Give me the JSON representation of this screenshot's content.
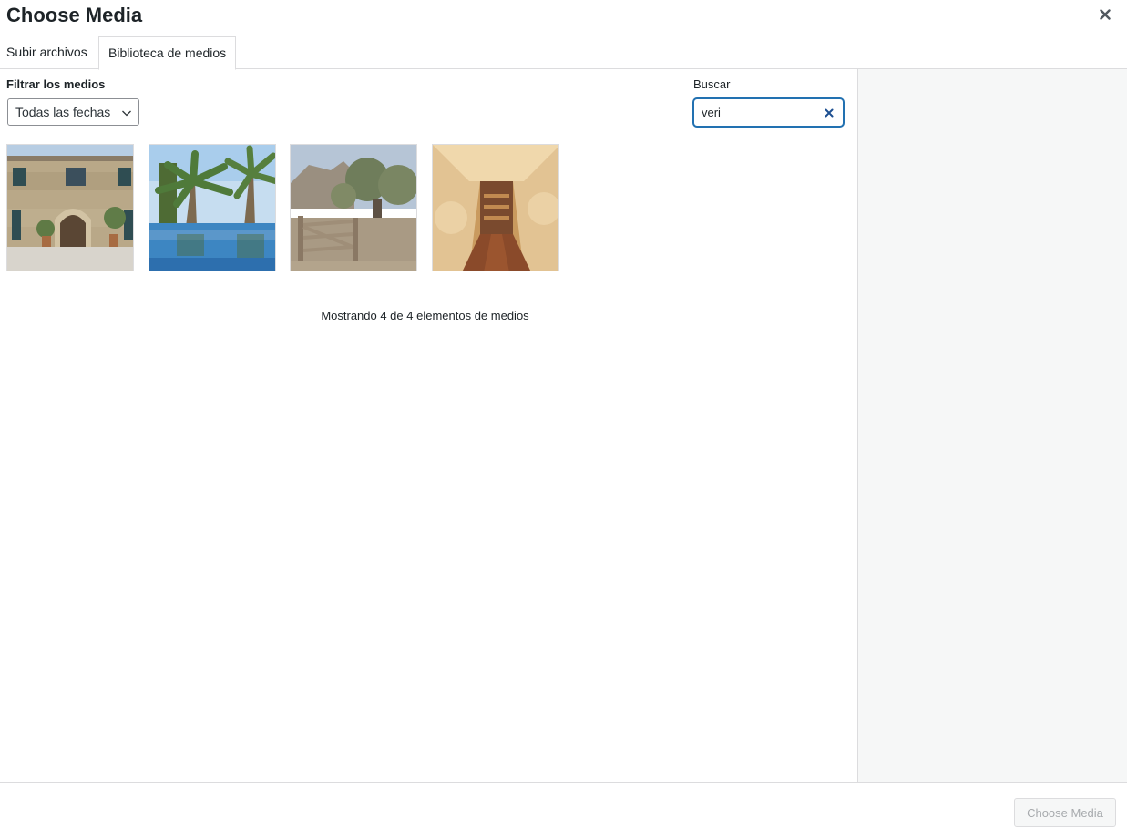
{
  "modal": {
    "title": "Choose Media"
  },
  "tabs": [
    {
      "label": "Subir archivos"
    },
    {
      "label": "Biblioteca de medios"
    }
  ],
  "filter": {
    "label": "Filtrar los medios",
    "selected": "Todas las fechas"
  },
  "search": {
    "label": "Buscar",
    "value": "veri"
  },
  "media": {
    "count_text": "Mostrando 4 de 4 elementos de medios"
  },
  "footer": {
    "choose_label": "Choose Media"
  },
  "icons": {
    "close": "close-icon",
    "chevron": "chevron-down-icon",
    "clear": "clear-search-icon"
  },
  "colors": {
    "accent": "#2271b1",
    "border": "#dcdcde",
    "sidebar_bg": "#f6f7f7",
    "disabled_text": "#a7aaad"
  }
}
